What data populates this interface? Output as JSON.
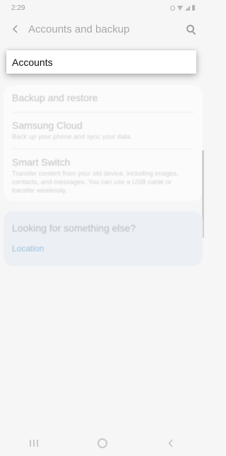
{
  "status_bar": {
    "time": "2:29"
  },
  "header": {
    "title": "Accounts and backup"
  },
  "accounts": {
    "label": "Accounts"
  },
  "group": {
    "items": [
      {
        "title": "Backup and restore"
      },
      {
        "title": "Samsung Cloud",
        "subtitle": "Back up your phone and sync your data."
      },
      {
        "title": "Smart Switch",
        "subtitle": "Transfer content from your old device, including images, contacts, and messages. You can use a USB cable or transfer wirelessly."
      }
    ]
  },
  "help": {
    "title": "Looking for something else?",
    "link": "Location"
  },
  "icons": {
    "back": "back-arrow-icon",
    "search": "search-icon",
    "nav_recent": "recent-apps-icon",
    "nav_home": "home-icon",
    "nav_back": "nav-back-icon"
  },
  "colors": {
    "link": "#9ac0e0",
    "background": "#f6f6f6"
  }
}
